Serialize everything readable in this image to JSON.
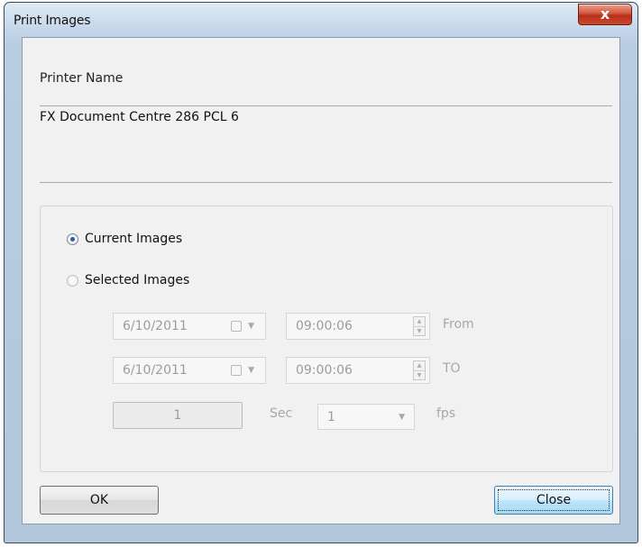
{
  "window": {
    "title": "Print Images",
    "close_glyph": "x"
  },
  "printer": {
    "label": "Printer Name",
    "value": "FX Document Centre 286 PCL 6"
  },
  "options": {
    "current_images_label": "Current Images",
    "current_images_checked": true,
    "selected_images_label": "Selected Images",
    "selected_images_checked": false
  },
  "range": {
    "from_date": "6/10/2011",
    "from_time": "09:00:06",
    "from_label": "From",
    "to_date": "6/10/2011",
    "to_time": "09:00:06",
    "to_label": "TO"
  },
  "interval": {
    "sec_value": "1",
    "sec_label": "Sec",
    "fps_value": "1",
    "fps_label": "fps"
  },
  "buttons": {
    "ok_label": "OK",
    "close_label": "Close"
  },
  "icons": {
    "calendar": "calendar-icon",
    "dropdown": "chevron-down-icon",
    "spin_up": "spin-up-icon",
    "spin_down": "spin-down-icon"
  },
  "colors": {
    "close_button": "#c9482e",
    "focus_button": "#bee6fd",
    "disabled_text": "#9c9c9c"
  }
}
